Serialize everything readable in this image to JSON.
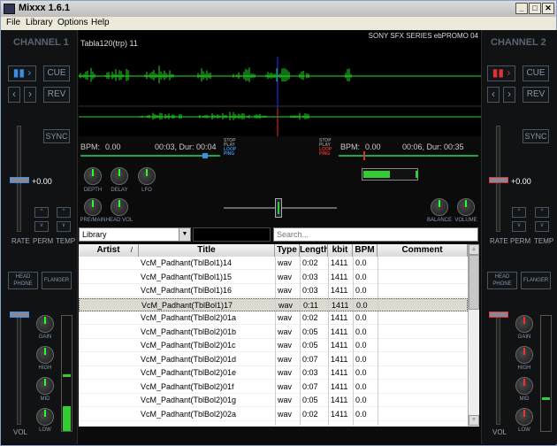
{
  "window": {
    "title": "Mixxx 1.6.1"
  },
  "menu": [
    "File",
    "Library",
    "Options",
    "Help"
  ],
  "deck1": {
    "header": "CHANNEL 1",
    "track": "Tabla120(trp) 11",
    "bpm_label": "BPM:",
    "bpm": "0.00",
    "time": "00:03, Dur: 00:04",
    "pitch": "+0.00",
    "buttons": {
      "cue": "CUE",
      "rev": "REV",
      "sync": "SYNC",
      "headphone": "HEAD\nPHONE",
      "flanger": "FLANGER"
    },
    "labels": {
      "rate": "RATE",
      "perm": "PERM",
      "temp": "TEMP",
      "vol": "VOL"
    }
  },
  "deck2": {
    "header": "CHANNEL 2",
    "track": "SONY SFX SERIES ebPROMO 04",
    "bpm_label": "BPM:",
    "bpm": "0.00",
    "time": "00:06, Dur: 00:35",
    "pitch": "+0.00",
    "buttons": {
      "cue": "CUE",
      "rev": "REV",
      "sync": "SYNC",
      "headphone": "HEAD\nPHONE",
      "flanger": "FLANGER"
    },
    "labels": {
      "rate": "RATE",
      "perm": "PERM",
      "temp": "TEMP",
      "vol": "VOL"
    }
  },
  "loop_labels": [
    "STOP",
    "PLAY",
    "LOOP",
    "PING"
  ],
  "mixer": {
    "knobs": [
      "DEPTH",
      "DELAY",
      "LFO"
    ],
    "premain": "PRE/MAIN",
    "headvol": "HEAD VOL",
    "balance": "BALANCE",
    "volume": "VOLUME",
    "eq": [
      "GAIN",
      "HIGH",
      "MID",
      "LOW"
    ]
  },
  "library": {
    "dropdown": "Library",
    "search_placeholder": "Search...",
    "columns": [
      "Artist",
      "Title",
      "Type",
      "Length",
      "kbit",
      "BPM",
      "Comment"
    ],
    "rows": [
      {
        "title": "VcM_Padhant(TblBol1)14",
        "type": "wav",
        "length": "0:02",
        "kbit": "1411",
        "bpm": "0.0"
      },
      {
        "title": "VcM_Padhant(TblBol1)15",
        "type": "wav",
        "length": "0:03",
        "kbit": "1411",
        "bpm": "0.0"
      },
      {
        "title": "VcM_Padhant(TblBol1)16",
        "type": "wav",
        "length": "0:03",
        "kbit": "1411",
        "bpm": "0.0"
      },
      {
        "title": "VcM_Padhant(TblBol1)17",
        "type": "wav",
        "length": "0:11",
        "kbit": "1411",
        "bpm": "0.0"
      },
      {
        "title": "VcM_Padhant(TblBol2)01a",
        "type": "wav",
        "length": "0:02",
        "kbit": "1411",
        "bpm": "0.0"
      },
      {
        "title": "VcM_Padhant(TblBol2)01b",
        "type": "wav",
        "length": "0:05",
        "kbit": "1411",
        "bpm": "0.0"
      },
      {
        "title": "VcM_Padhant(TblBol2)01c",
        "type": "wav",
        "length": "0:05",
        "kbit": "1411",
        "bpm": "0.0"
      },
      {
        "title": "VcM_Padhant(TblBol2)01d",
        "type": "wav",
        "length": "0:07",
        "kbit": "1411",
        "bpm": "0.0"
      },
      {
        "title": "VcM_Padhant(TblBol2)01e",
        "type": "wav",
        "length": "0:03",
        "kbit": "1411",
        "bpm": "0.0"
      },
      {
        "title": "VcM_Padhant(TblBol2)01f",
        "type": "wav",
        "length": "0:07",
        "kbit": "1411",
        "bpm": "0.0"
      },
      {
        "title": "VcM_Padhant(TblBol2)01g",
        "type": "wav",
        "length": "0:05",
        "kbit": "1411",
        "bpm": "0.0"
      },
      {
        "title": "VcM_Padhant(TblBol2)02a",
        "type": "wav",
        "length": "0:02",
        "kbit": "1411",
        "bpm": "0.0"
      }
    ],
    "selected_index": 3
  },
  "colors": {
    "waveform": "#22dd22",
    "deck1_accent": "#3a8ee6",
    "deck2_accent": "#e03030"
  }
}
